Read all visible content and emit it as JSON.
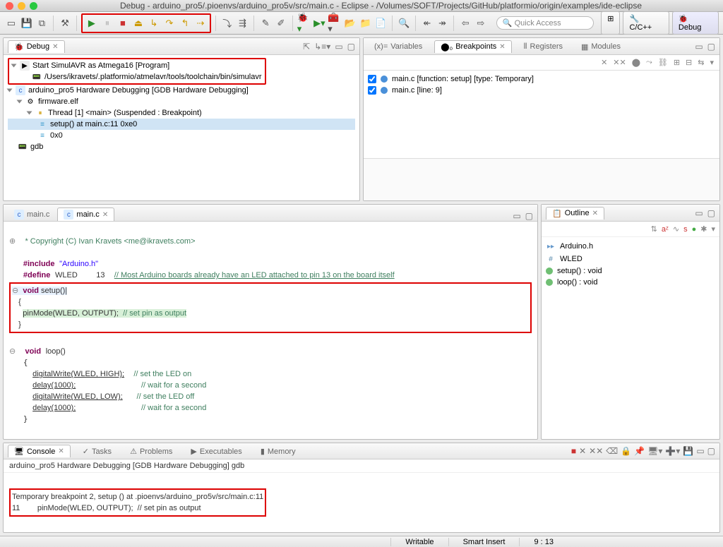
{
  "window": {
    "title": "Debug - arduino_pro5/.pioenvs/arduino_pro5v/src/main.c - Eclipse - /Volumes/SOFT/Projects/GitHub/platformio/origin/examples/ide-eclipse"
  },
  "quick_access_placeholder": "Quick Access",
  "perspectives": {
    "cpp": "C/C++",
    "debug": "Debug"
  },
  "debug_view": {
    "title": "Debug",
    "tree": {
      "program_label": "Start SimulAVR as Atmega16 [Program]",
      "program_path": "/Users/ikravets/.platformio/atmelavr/tools/toolchain/bin/simulavr",
      "hw_label": "arduino_pro5 Hardware Debugging [GDB Hardware Debugging]",
      "firmware": "firmware.elf",
      "thread": "Thread [1] <main> (Suspended : Breakpoint)",
      "frame0": "setup() at main.c:11 0xe0",
      "frame1": "0x0",
      "gdb": "gdb"
    }
  },
  "bp_view": {
    "tabs": {
      "variables": "Variables",
      "breakpoints": "Breakpoints",
      "registers": "Registers",
      "modules": "Modules"
    },
    "items": [
      {
        "label": "main.c [function: setup] [type: Temporary]"
      },
      {
        "label": "main.c [line: 9]"
      }
    ]
  },
  "editor": {
    "tabs": {
      "main1": "main.c",
      "main2": "main.c"
    },
    "copyright": "* Copyright (C) Ivan Kravets <me@ikravets.com>",
    "include_kw": "#include",
    "include_val": "\"Arduino.h\"",
    "define_kw": "#define",
    "define_sym": "WLED",
    "define_val": "13",
    "define_cmt": "// Most Arduino boards already have an LED attached to pin 13 on the board itself",
    "void_kw": "void",
    "setup_fn": "setup()",
    "pinmode_line": "pinMode(WLED, OUTPUT);",
    "pinmode_cmt": "// set pin as output",
    "loop_fn": "loop()",
    "dw_high": "digitalWrite(WLED, HIGH);",
    "dw_high_cmt": "// set the LED on",
    "delay1": "delay(1000);",
    "delay1_cmt": "// wait for a second",
    "dw_low": "digitalWrite(WLED, LOW);",
    "dw_low_cmt": "// set the LED off",
    "delay2": "delay(1000);",
    "delay2_cmt": "// wait for a second"
  },
  "outline": {
    "title": "Outline",
    "items": [
      {
        "label": "Arduino.h",
        "color": "#7aa3c9",
        "shape": "sq"
      },
      {
        "label": "WLED",
        "color": "#5a7fb8",
        "shape": "hash"
      },
      {
        "label": "setup() : void",
        "color": "#6fbf73",
        "shape": "circ"
      },
      {
        "label": "loop() : void",
        "color": "#6fbf73",
        "shape": "circ"
      }
    ]
  },
  "console": {
    "tabs": {
      "console": "Console",
      "tasks": "Tasks",
      "problems": "Problems",
      "executables": "Executables",
      "memory": "Memory"
    },
    "header": "arduino_pro5 Hardware Debugging [GDB Hardware Debugging] gdb",
    "line1": "Temporary breakpoint 2, setup () at .pioenvs/arduino_pro5v/src/main.c:11",
    "line2": "11        pinMode(WLED, OUTPUT);  // set pin as output"
  },
  "statusbar": {
    "writable": "Writable",
    "insert": "Smart Insert",
    "pos": "9 : 13"
  }
}
